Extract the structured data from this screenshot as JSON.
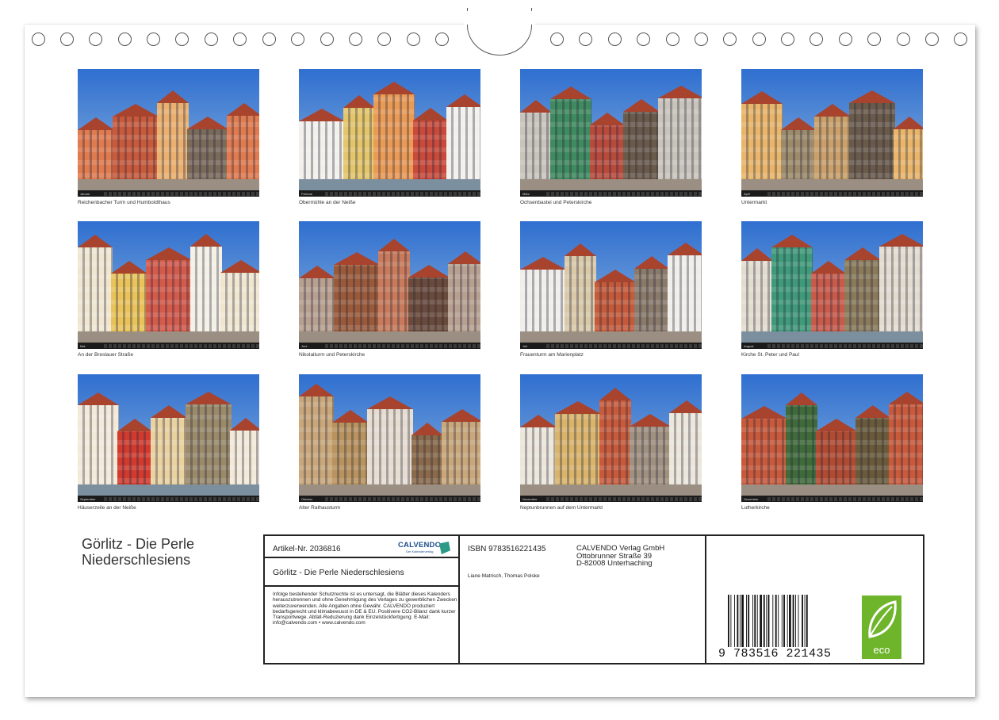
{
  "calendar": {
    "months": [
      {
        "label": "Januar",
        "caption": "Reichenbacher Turm und Humboldthaus"
      },
      {
        "label": "Februar",
        "caption": "Obermühle an der Neiße"
      },
      {
        "label": "März",
        "caption": "Ochsenbastei und Peterskirche"
      },
      {
        "label": "April",
        "caption": "Untermarkt"
      },
      {
        "label": "Mai",
        "caption": "An der Breslauer Straße"
      },
      {
        "label": "Juni",
        "caption": "Nikolaiturm und Peterskirche"
      },
      {
        "label": "Juli",
        "caption": "Frauenturm am Marienplatz"
      },
      {
        "label": "August",
        "caption": "Kirche St. Peter und Paul"
      },
      {
        "label": "September",
        "caption": "Häuserzeile an der Neiße"
      },
      {
        "label": "Oktober",
        "caption": "Alter Rathausturm"
      },
      {
        "label": "November",
        "caption": "Neptunbrunnen auf dem Untermarkt"
      },
      {
        "label": "Dezember",
        "caption": "Lutherkirche"
      }
    ]
  },
  "title": {
    "line1": "Görlitz - Die Perle",
    "line2": "Niederschlesiens"
  },
  "info": {
    "article": "Artikel-Nr. 2036816",
    "logo_text": "CALVENDO",
    "logo_sub": "Der Kalenderverlag",
    "subtitle": "Görlitz - Die Perle Niederschlesiens",
    "legal": "Infolge bestehender Schutzrechte ist es untersagt, die Blätter dieses Kalenders herauszutrennen und ohne Genehmigung des Verlages zu gewerblichen Zwecken weiterzuverwenden. Alle Angaben ohne Gewähr. CALVENDO produziert bedarfsgerecht und klimabewusst in DE & EU. Positivere CO2-Bilanz dank kurzer Transportwege. Abfall-Reduzierung dank Einzelstückfertigung. E-Mail: info@calvendo.com • www.calvendo.com",
    "isbn": "ISBN 9783516221435",
    "authors": "Liane Matrisch, Thomas Polske",
    "publisher_line1": "CALVENDO Verlag GmbH",
    "publisher_line2": "Ottobrunner Straße 39",
    "publisher_line3": "D-82008 Unterhaching",
    "barcode_digits": "9 783516 221435",
    "eco_label": "eco"
  },
  "colors": {
    "sky": "#4f84cc",
    "eco_green": "#6fb52c",
    "logo_blue": "#1e4e8c"
  }
}
